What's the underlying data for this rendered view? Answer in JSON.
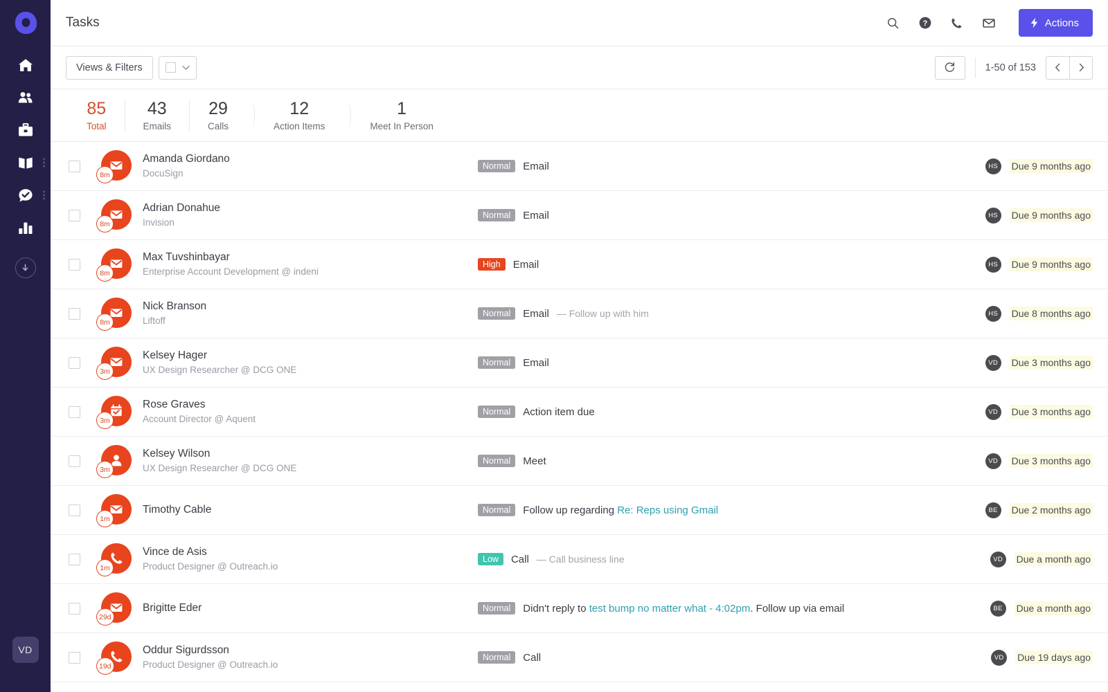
{
  "brand": {
    "logo_name": "outreach-logo",
    "accent": "#5a51e8",
    "sidebar_bg": "#231f47",
    "danger": "#e8441e"
  },
  "sidebar": {
    "items": [
      {
        "name": "home",
        "icon": "home-icon",
        "kebab": false
      },
      {
        "name": "people",
        "icon": "people-icon",
        "kebab": false
      },
      {
        "name": "briefcase",
        "icon": "briefcase-icon",
        "kebab": false
      },
      {
        "name": "content",
        "icon": "book-icon",
        "kebab": true
      },
      {
        "name": "tasks",
        "icon": "task-check-icon",
        "kebab": true
      },
      {
        "name": "reports",
        "icon": "bar-chart-icon",
        "kebab": false
      }
    ],
    "download_icon": "download-circle-icon",
    "user_initials": "VD"
  },
  "header": {
    "title": "Tasks",
    "icons": [
      {
        "name": "search-icon"
      },
      {
        "name": "help-icon"
      },
      {
        "name": "phone-icon"
      },
      {
        "name": "mail-icon"
      }
    ],
    "actions_label": "Actions",
    "actions_icon": "bolt-icon"
  },
  "filterbar": {
    "views_filters_label": "Views & Filters",
    "select_icon": "chevron-down-icon",
    "checkbox_icon": "checkbox-icon",
    "refresh_icon": "refresh-icon",
    "pagination_text": "1-50 of 153",
    "prev_icon": "chevron-left-icon",
    "next_icon": "chevron-right-icon"
  },
  "stats": [
    {
      "num": "85",
      "label": "Total",
      "highlight": true
    },
    {
      "num": "43",
      "label": "Emails",
      "highlight": false
    },
    {
      "num": "29",
      "label": "Calls",
      "highlight": false
    },
    {
      "num": "12",
      "label": "Action Items",
      "highlight": false
    },
    {
      "num": "1",
      "label": "Meet In Person",
      "highlight": false
    }
  ],
  "rows": [
    {
      "name": "Amanda Giordano",
      "sub": "DocuSign",
      "icon": "envelope-icon",
      "badge": "8m",
      "priority": "Normal",
      "priority_class": "normal",
      "desc_main": "Email",
      "desc_muted": "",
      "desc_link": "",
      "desc_tail": "",
      "owner": "HS",
      "due": "Due 9 months ago"
    },
    {
      "name": "Adrian Donahue",
      "sub": "Invision",
      "icon": "envelope-icon",
      "badge": "8m",
      "priority": "Normal",
      "priority_class": "normal",
      "desc_main": "Email",
      "desc_muted": "",
      "desc_link": "",
      "desc_tail": "",
      "owner": "HS",
      "due": "Due 9 months ago"
    },
    {
      "name": "Max Tuvshinbayar",
      "sub": "Enterprise Account Development @ indeni",
      "icon": "envelope-icon",
      "badge": "8m",
      "priority": "High",
      "priority_class": "high",
      "desc_main": "Email",
      "desc_muted": "",
      "desc_link": "",
      "desc_tail": "",
      "owner": "HS",
      "due": "Due 9 months ago"
    },
    {
      "name": "Nick Branson",
      "sub": "Liftoff",
      "icon": "envelope-icon",
      "badge": "8m",
      "priority": "Normal",
      "priority_class": "normal",
      "desc_main": "Email",
      "desc_muted": "— Follow up with him",
      "desc_link": "",
      "desc_tail": "",
      "owner": "HS",
      "due": "Due 8 months ago"
    },
    {
      "name": "Kelsey Hager",
      "sub": "UX Design Researcher @ DCG ONE",
      "icon": "envelope-icon",
      "badge": "3m",
      "priority": "Normal",
      "priority_class": "normal",
      "desc_main": "Email",
      "desc_muted": "",
      "desc_link": "",
      "desc_tail": "",
      "owner": "VD",
      "due": "Due 3 months ago"
    },
    {
      "name": "Rose Graves",
      "sub": "Account Director @ Aquent",
      "icon": "calendar-check-icon",
      "badge": "3m",
      "priority": "Normal",
      "priority_class": "normal",
      "desc_main": "Action item due",
      "desc_muted": "",
      "desc_link": "",
      "desc_tail": "",
      "owner": "VD",
      "due": "Due 3 months ago"
    },
    {
      "name": "Kelsey Wilson",
      "sub": "UX Design Researcher @ DCG ONE",
      "icon": "person-icon",
      "badge": "3m",
      "priority": "Normal",
      "priority_class": "normal",
      "desc_main": "Meet",
      "desc_muted": "",
      "desc_link": "",
      "desc_tail": "",
      "owner": "VD",
      "due": "Due 3 months ago"
    },
    {
      "name": "Timothy Cable",
      "sub": "",
      "icon": "envelope-icon",
      "badge": "1m",
      "priority": "Normal",
      "priority_class": "normal",
      "desc_main": "Follow up regarding",
      "desc_muted": "",
      "desc_link": "Re: Reps using Gmail",
      "desc_tail": "",
      "owner": "BE",
      "due": "Due 2 months ago"
    },
    {
      "name": "Vince de Asis",
      "sub": "Product Designer @ Outreach.io",
      "icon": "phone-icon",
      "badge": "1m",
      "priority": "Low",
      "priority_class": "low",
      "desc_main": "Call",
      "desc_muted": "— Call business line",
      "desc_link": "",
      "desc_tail": "",
      "owner": "VD",
      "due": "Due a month ago"
    },
    {
      "name": "Brigitte Eder",
      "sub": "",
      "icon": "envelope-icon",
      "badge": "29d",
      "priority": "Normal",
      "priority_class": "normal",
      "desc_main": "Didn't reply to",
      "desc_muted": "",
      "desc_link": "test bump no matter what - 4:02pm",
      "desc_tail": ". Follow up via email",
      "owner": "BE",
      "due": "Due a month ago"
    },
    {
      "name": "Oddur Sigurdsson",
      "sub": "Product Designer @ Outreach.io",
      "icon": "phone-icon",
      "badge": "19d",
      "priority": "Normal",
      "priority_class": "normal",
      "desc_main": "Call",
      "desc_muted": "",
      "desc_link": "",
      "desc_tail": "",
      "owner": "VD",
      "due": "Due 19 days ago"
    }
  ]
}
